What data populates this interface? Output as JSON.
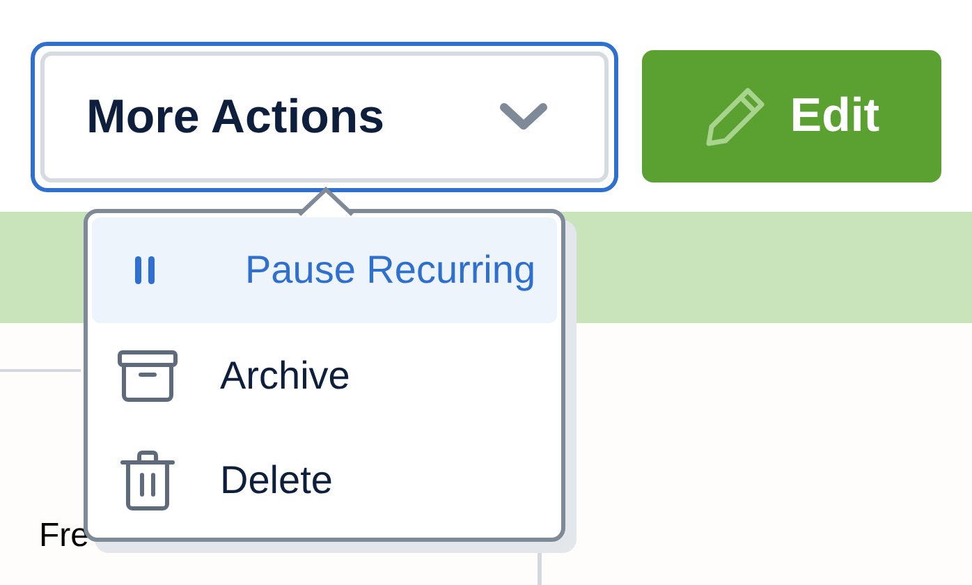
{
  "more_actions_button": {
    "label": "More Actions",
    "expanded": true
  },
  "edit_button": {
    "label": "Edit"
  },
  "menu": {
    "items": [
      {
        "label": "Pause Recurring",
        "kind": "pause",
        "selected": true
      },
      {
        "label": "Archive",
        "kind": "archive",
        "selected": false
      },
      {
        "label": "Delete",
        "kind": "delete",
        "selected": false
      }
    ]
  },
  "content": {
    "row_text": "Fre"
  }
}
